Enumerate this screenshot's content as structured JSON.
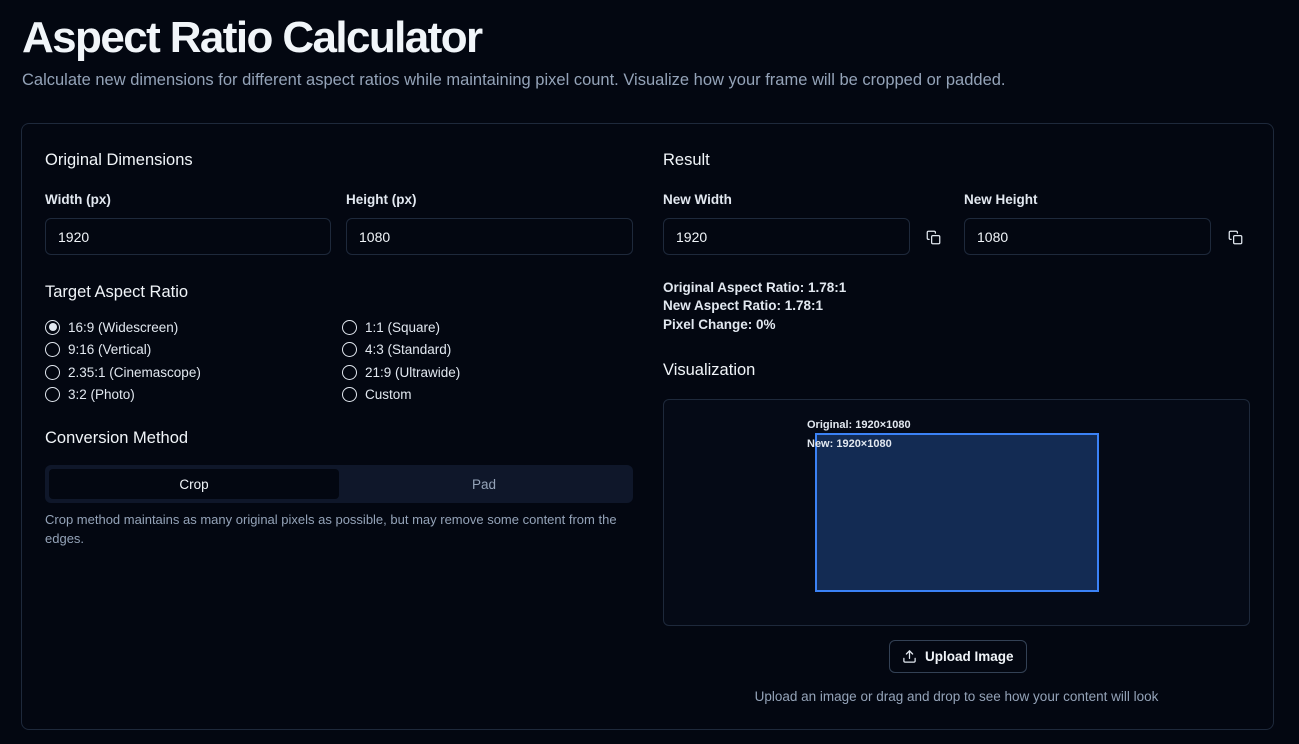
{
  "header": {
    "title": "Aspect Ratio Calculator",
    "subtitle": "Calculate new dimensions for different aspect ratios while maintaining pixel count. Visualize how your frame will be cropped or padded."
  },
  "original": {
    "title": "Original Dimensions",
    "width_label": "Width (px)",
    "width_value": "1920",
    "height_label": "Height (px)",
    "height_value": "1080"
  },
  "target": {
    "title": "Target Aspect Ratio",
    "options": [
      {
        "label": "16:9 (Widescreen)",
        "checked": true
      },
      {
        "label": "1:1 (Square)",
        "checked": false
      },
      {
        "label": "9:16 (Vertical)",
        "checked": false
      },
      {
        "label": "4:3 (Standard)",
        "checked": false
      },
      {
        "label": "2.35:1 (Cinemascope)",
        "checked": false
      },
      {
        "label": "21:9 (Ultrawide)",
        "checked": false
      },
      {
        "label": "3:2 (Photo)",
        "checked": false
      },
      {
        "label": "Custom",
        "checked": false
      }
    ]
  },
  "method": {
    "title": "Conversion Method",
    "crop_label": "Crop",
    "pad_label": "Pad",
    "selected": "Crop",
    "note": "Crop method maintains as many original pixels as possible, but may remove some content from the edges."
  },
  "result": {
    "title": "Result",
    "new_width_label": "New Width",
    "new_width_value": "1920",
    "new_height_label": "New Height",
    "new_height_value": "1080",
    "original_ratio": "Original Aspect Ratio: 1.78:1",
    "new_ratio": "New Aspect Ratio: 1.78:1",
    "pixel_change": "Pixel Change: 0%"
  },
  "visualization": {
    "title": "Visualization",
    "original_label": "Original: 1920×1080",
    "new_label": "New: 1920×1080",
    "upload_label": "Upload Image",
    "hint": "Upload an image or drag and drop to see how your content will look"
  },
  "colors": {
    "accent": "#3b82f6",
    "background": "#030711",
    "border": "#1e293b"
  },
  "icons": {
    "copy": "copy-icon",
    "upload": "upload-icon"
  }
}
